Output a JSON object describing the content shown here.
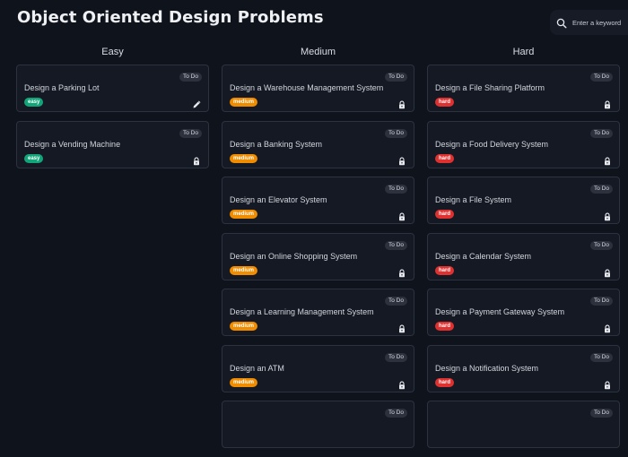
{
  "header": {
    "title": "Object Oriented Design Problems"
  },
  "search": {
    "placeholder": "Enter a keyword",
    "value": "",
    "icon": "search-icon"
  },
  "colors": {
    "background": "#0f131c",
    "card_background": "#141923",
    "card_border": "#2c3240",
    "easy": "#13a57a",
    "medium": "#f08c00",
    "hard": "#e03131"
  },
  "columns": [
    {
      "key": "easy",
      "title": "Easy",
      "cards": [
        {
          "title": "Design a Parking Lot",
          "status": "To Do",
          "difficulty": "easy",
          "icon": "edit-icon"
        },
        {
          "title": "Design a Vending Machine",
          "status": "To Do",
          "difficulty": "easy",
          "icon": "lock-icon"
        }
      ]
    },
    {
      "key": "medium",
      "title": "Medium",
      "cards": [
        {
          "title": "Design a Warehouse Management System",
          "status": "To Do",
          "difficulty": "medium",
          "icon": "lock-icon"
        },
        {
          "title": "Design a Banking System",
          "status": "To Do",
          "difficulty": "medium",
          "icon": "lock-icon"
        },
        {
          "title": "Design an Elevator System",
          "status": "To Do",
          "difficulty": "medium",
          "icon": "lock-icon"
        },
        {
          "title": "Design an Online Shopping System",
          "status": "To Do",
          "difficulty": "medium",
          "icon": "lock-icon"
        },
        {
          "title": "Design a Learning Management System",
          "status": "To Do",
          "difficulty": "medium",
          "icon": "lock-icon"
        },
        {
          "title": "Design an ATM",
          "status": "To Do",
          "difficulty": "medium",
          "icon": "lock-icon"
        },
        {
          "title": "",
          "status": "To Do",
          "difficulty": "",
          "icon": ""
        }
      ]
    },
    {
      "key": "hard",
      "title": "Hard",
      "cards": [
        {
          "title": "Design a File Sharing Platform",
          "status": "To Do",
          "difficulty": "hard",
          "icon": "lock-icon"
        },
        {
          "title": "Design a Food Delivery System",
          "status": "To Do",
          "difficulty": "hard",
          "icon": "lock-icon"
        },
        {
          "title": "Design a File System",
          "status": "To Do",
          "difficulty": "hard",
          "icon": "lock-icon"
        },
        {
          "title": "Design a Calendar System",
          "status": "To Do",
          "difficulty": "hard",
          "icon": "lock-icon"
        },
        {
          "title": "Design a Payment Gateway System",
          "status": "To Do",
          "difficulty": "hard",
          "icon": "lock-icon"
        },
        {
          "title": "Design a Notification System",
          "status": "To Do",
          "difficulty": "hard",
          "icon": "lock-icon"
        },
        {
          "title": "",
          "status": "To Do",
          "difficulty": "",
          "icon": ""
        }
      ]
    }
  ]
}
